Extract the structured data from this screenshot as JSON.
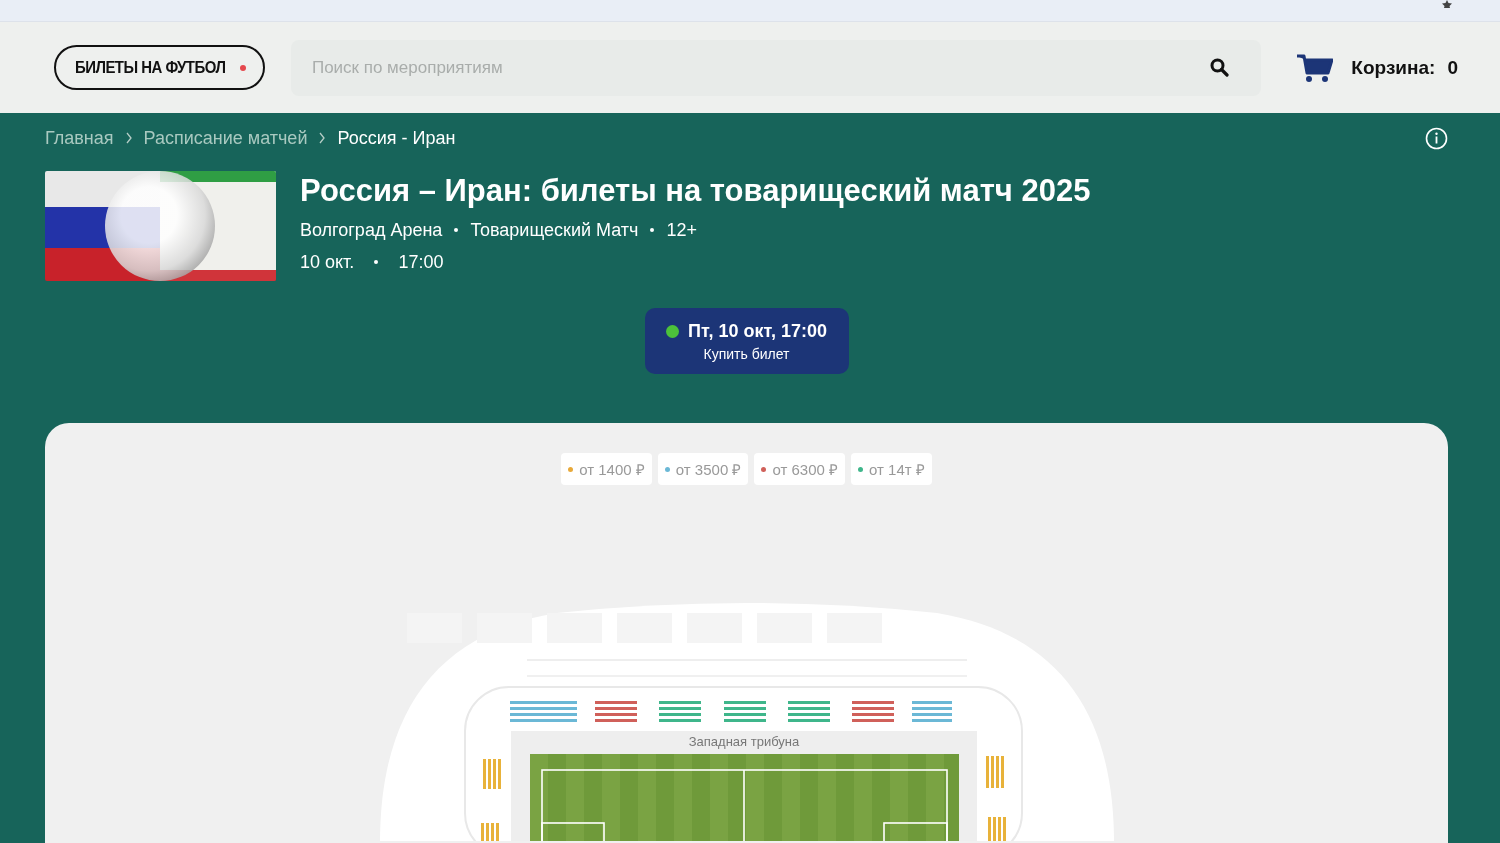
{
  "header": {
    "logo": "БИЛЕТЫ НА ФУТБОЛ",
    "search": {
      "placeholder": "Поиск по мероприятиям"
    },
    "cart": {
      "label": "Корзина:",
      "count": "0"
    }
  },
  "breadcrumbs": [
    {
      "label": "Главная",
      "current": false
    },
    {
      "label": "Расписание матчей",
      "current": false
    },
    {
      "label": "Россия - Иран",
      "current": true
    }
  ],
  "event": {
    "title": "Россия – Иран: билеты на товарищеский матч 2025",
    "venue": "Волгоград Арена",
    "category": "Товарищеский Матч",
    "age": "12+",
    "date": "10 окт.",
    "time": "17:00"
  },
  "session": {
    "datetime": "Пт, 10 окт, 17:00",
    "action": "Купить билет",
    "available": true
  },
  "price_legend": [
    {
      "label": "от 1400 ₽",
      "color": "#e8a93a"
    },
    {
      "label": "от 3500 ₽",
      "color": "#6bb8d6"
    },
    {
      "label": "от 6300 ₽",
      "color": "#d0605a"
    },
    {
      "label": "от 14т ₽",
      "color": "#3fb68b"
    }
  ],
  "map": {
    "stand_label": "Западная трибуна"
  }
}
